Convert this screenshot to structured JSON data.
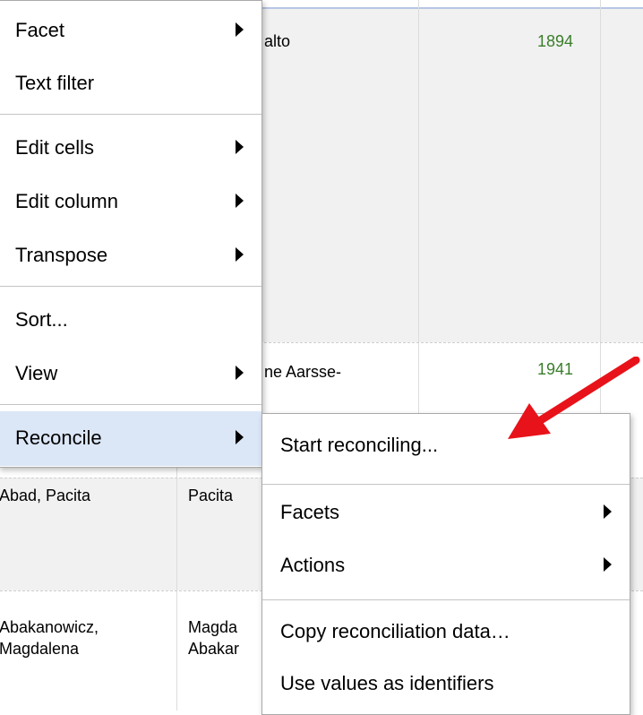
{
  "grid": {
    "rows": [
      {
        "name": "alto",
        "year": "1894"
      },
      {
        "name": "ne Aarsse-",
        "year": "1941"
      },
      {
        "col1": "Abad, Pacita",
        "col2": "Pacita"
      },
      {
        "col1": "Abakanowicz,",
        "col1b": "Magdalena",
        "col2": "Magda",
        "col2b": "Abakar"
      }
    ]
  },
  "column_menu": {
    "items": [
      {
        "label": "Facet",
        "submenu": true
      },
      {
        "label": "Text filter",
        "submenu": false
      },
      {
        "label": "Edit cells",
        "submenu": true
      },
      {
        "label": "Edit column",
        "submenu": true
      },
      {
        "label": "Transpose",
        "submenu": true
      },
      {
        "label": "Sort...",
        "submenu": false
      },
      {
        "label": "View",
        "submenu": true
      },
      {
        "label": "Reconcile",
        "submenu": true,
        "active": true
      }
    ]
  },
  "reconcile_menu": {
    "items": [
      {
        "label": "Start reconciling...",
        "submenu": false
      },
      {
        "label": "Facets",
        "submenu": true
      },
      {
        "label": "Actions",
        "submenu": true
      },
      {
        "label": "Copy reconciliation data…",
        "submenu": false
      },
      {
        "label": "Use values as identifiers",
        "submenu": false
      }
    ]
  },
  "colors": {
    "menu_bg": "#ffffff",
    "active_bg": "#dbe6f6",
    "year_text": "#3a7d2a",
    "annotation_arrow": "#e8121a"
  },
  "icons": [
    "submenu-arrow-icon",
    "annotation-arrow"
  ]
}
